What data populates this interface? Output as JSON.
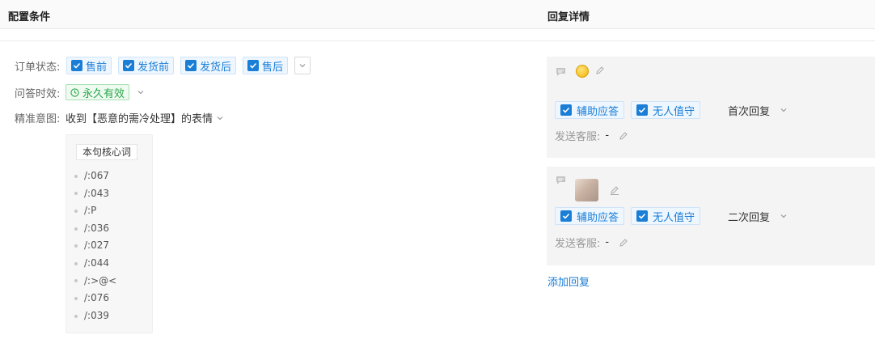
{
  "header": {
    "left_title": "配置条件",
    "right_title": "回复详情"
  },
  "order_status": {
    "label": "订单状态:",
    "options": [
      "售前",
      "发货前",
      "发货后",
      "售后"
    ]
  },
  "validity": {
    "label": "问答时效:",
    "value": "永久有效"
  },
  "intent": {
    "label": "精准意图:",
    "value": "收到【恶意的需冷处理】的表情"
  },
  "keywords": {
    "title": "本句核心词",
    "items": [
      "/:067",
      "/:043",
      "/:P",
      "/:036",
      "/:027",
      "/:044",
      "/:>@<",
      "/:076",
      "/:039"
    ]
  },
  "replies": [
    {
      "tags": [
        "辅助应答",
        "无人值守"
      ],
      "order": "首次回复",
      "send_label": "发送客服:",
      "send_value": "-"
    },
    {
      "tags": [
        "辅助应答",
        "无人值守"
      ],
      "order": "二次回复",
      "send_label": "发送客服:",
      "send_value": "-"
    }
  ],
  "add_reply": "添加回复",
  "colors": {
    "accent": "#1a7ed6",
    "success": "#2aa84a"
  }
}
